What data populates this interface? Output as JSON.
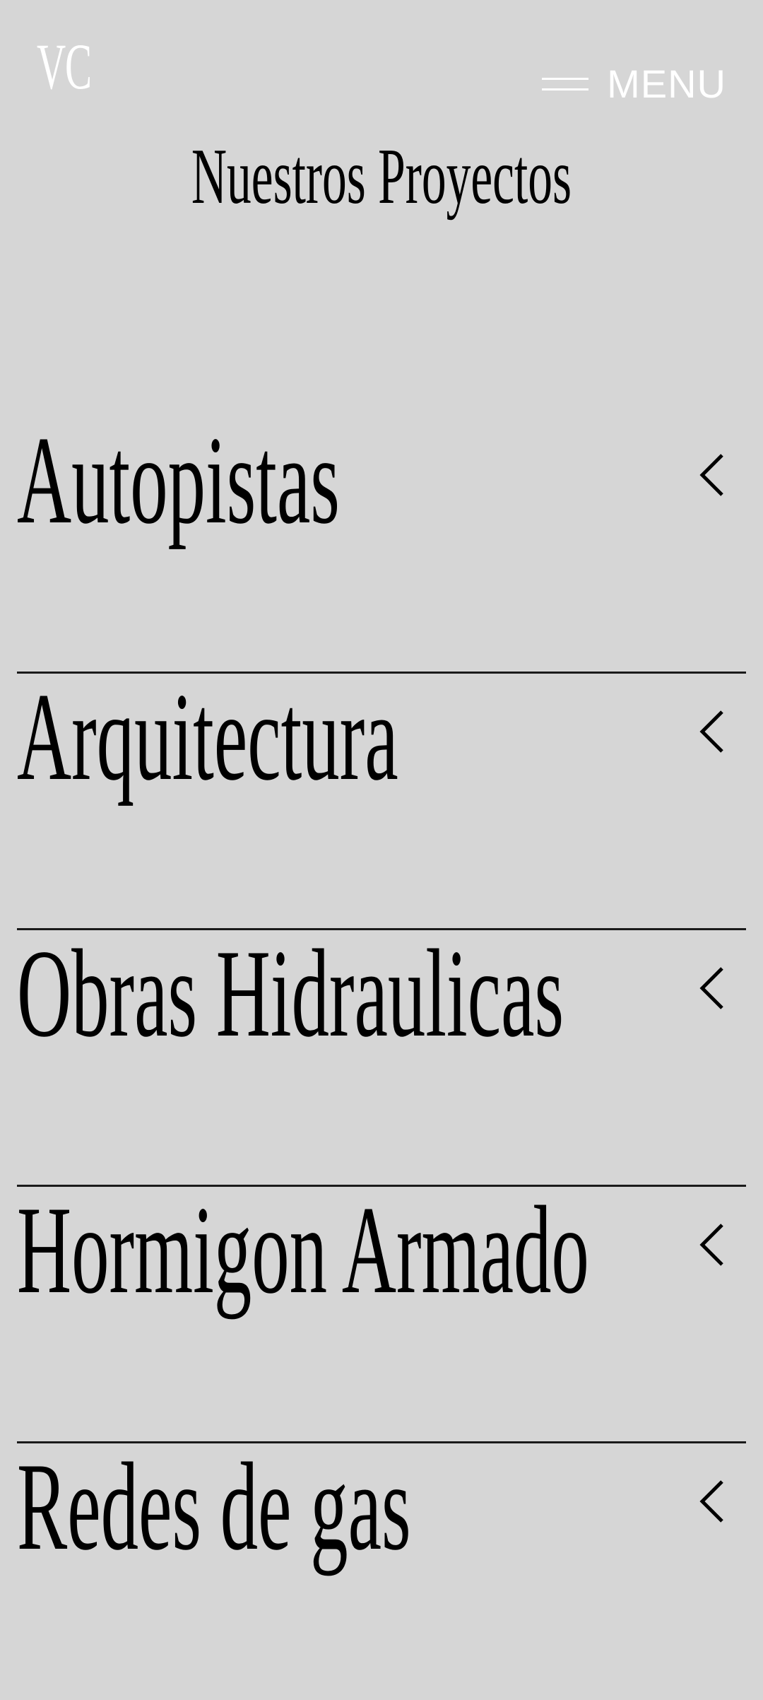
{
  "header": {
    "logo_text": "VC",
    "menu_label": "MENU"
  },
  "page": {
    "title": "Nuestros Proyectos"
  },
  "projects": [
    {
      "label": "Autopistas",
      "icon": "chevron-left-icon"
    },
    {
      "label": "Arquitectura",
      "icon": "chevron-left-icon"
    },
    {
      "label": "Obras Hidraulicas",
      "icon": "chevron-left-icon"
    },
    {
      "label": "Hormigon Armado",
      "icon": "chevron-left-icon"
    },
    {
      "label": "Redes de gas",
      "icon": "chevron-left-icon"
    }
  ],
  "colors": {
    "background": "#d6d6d6",
    "header_text": "#ffffff",
    "text": "#000000",
    "divider": "#1a1a1a"
  }
}
